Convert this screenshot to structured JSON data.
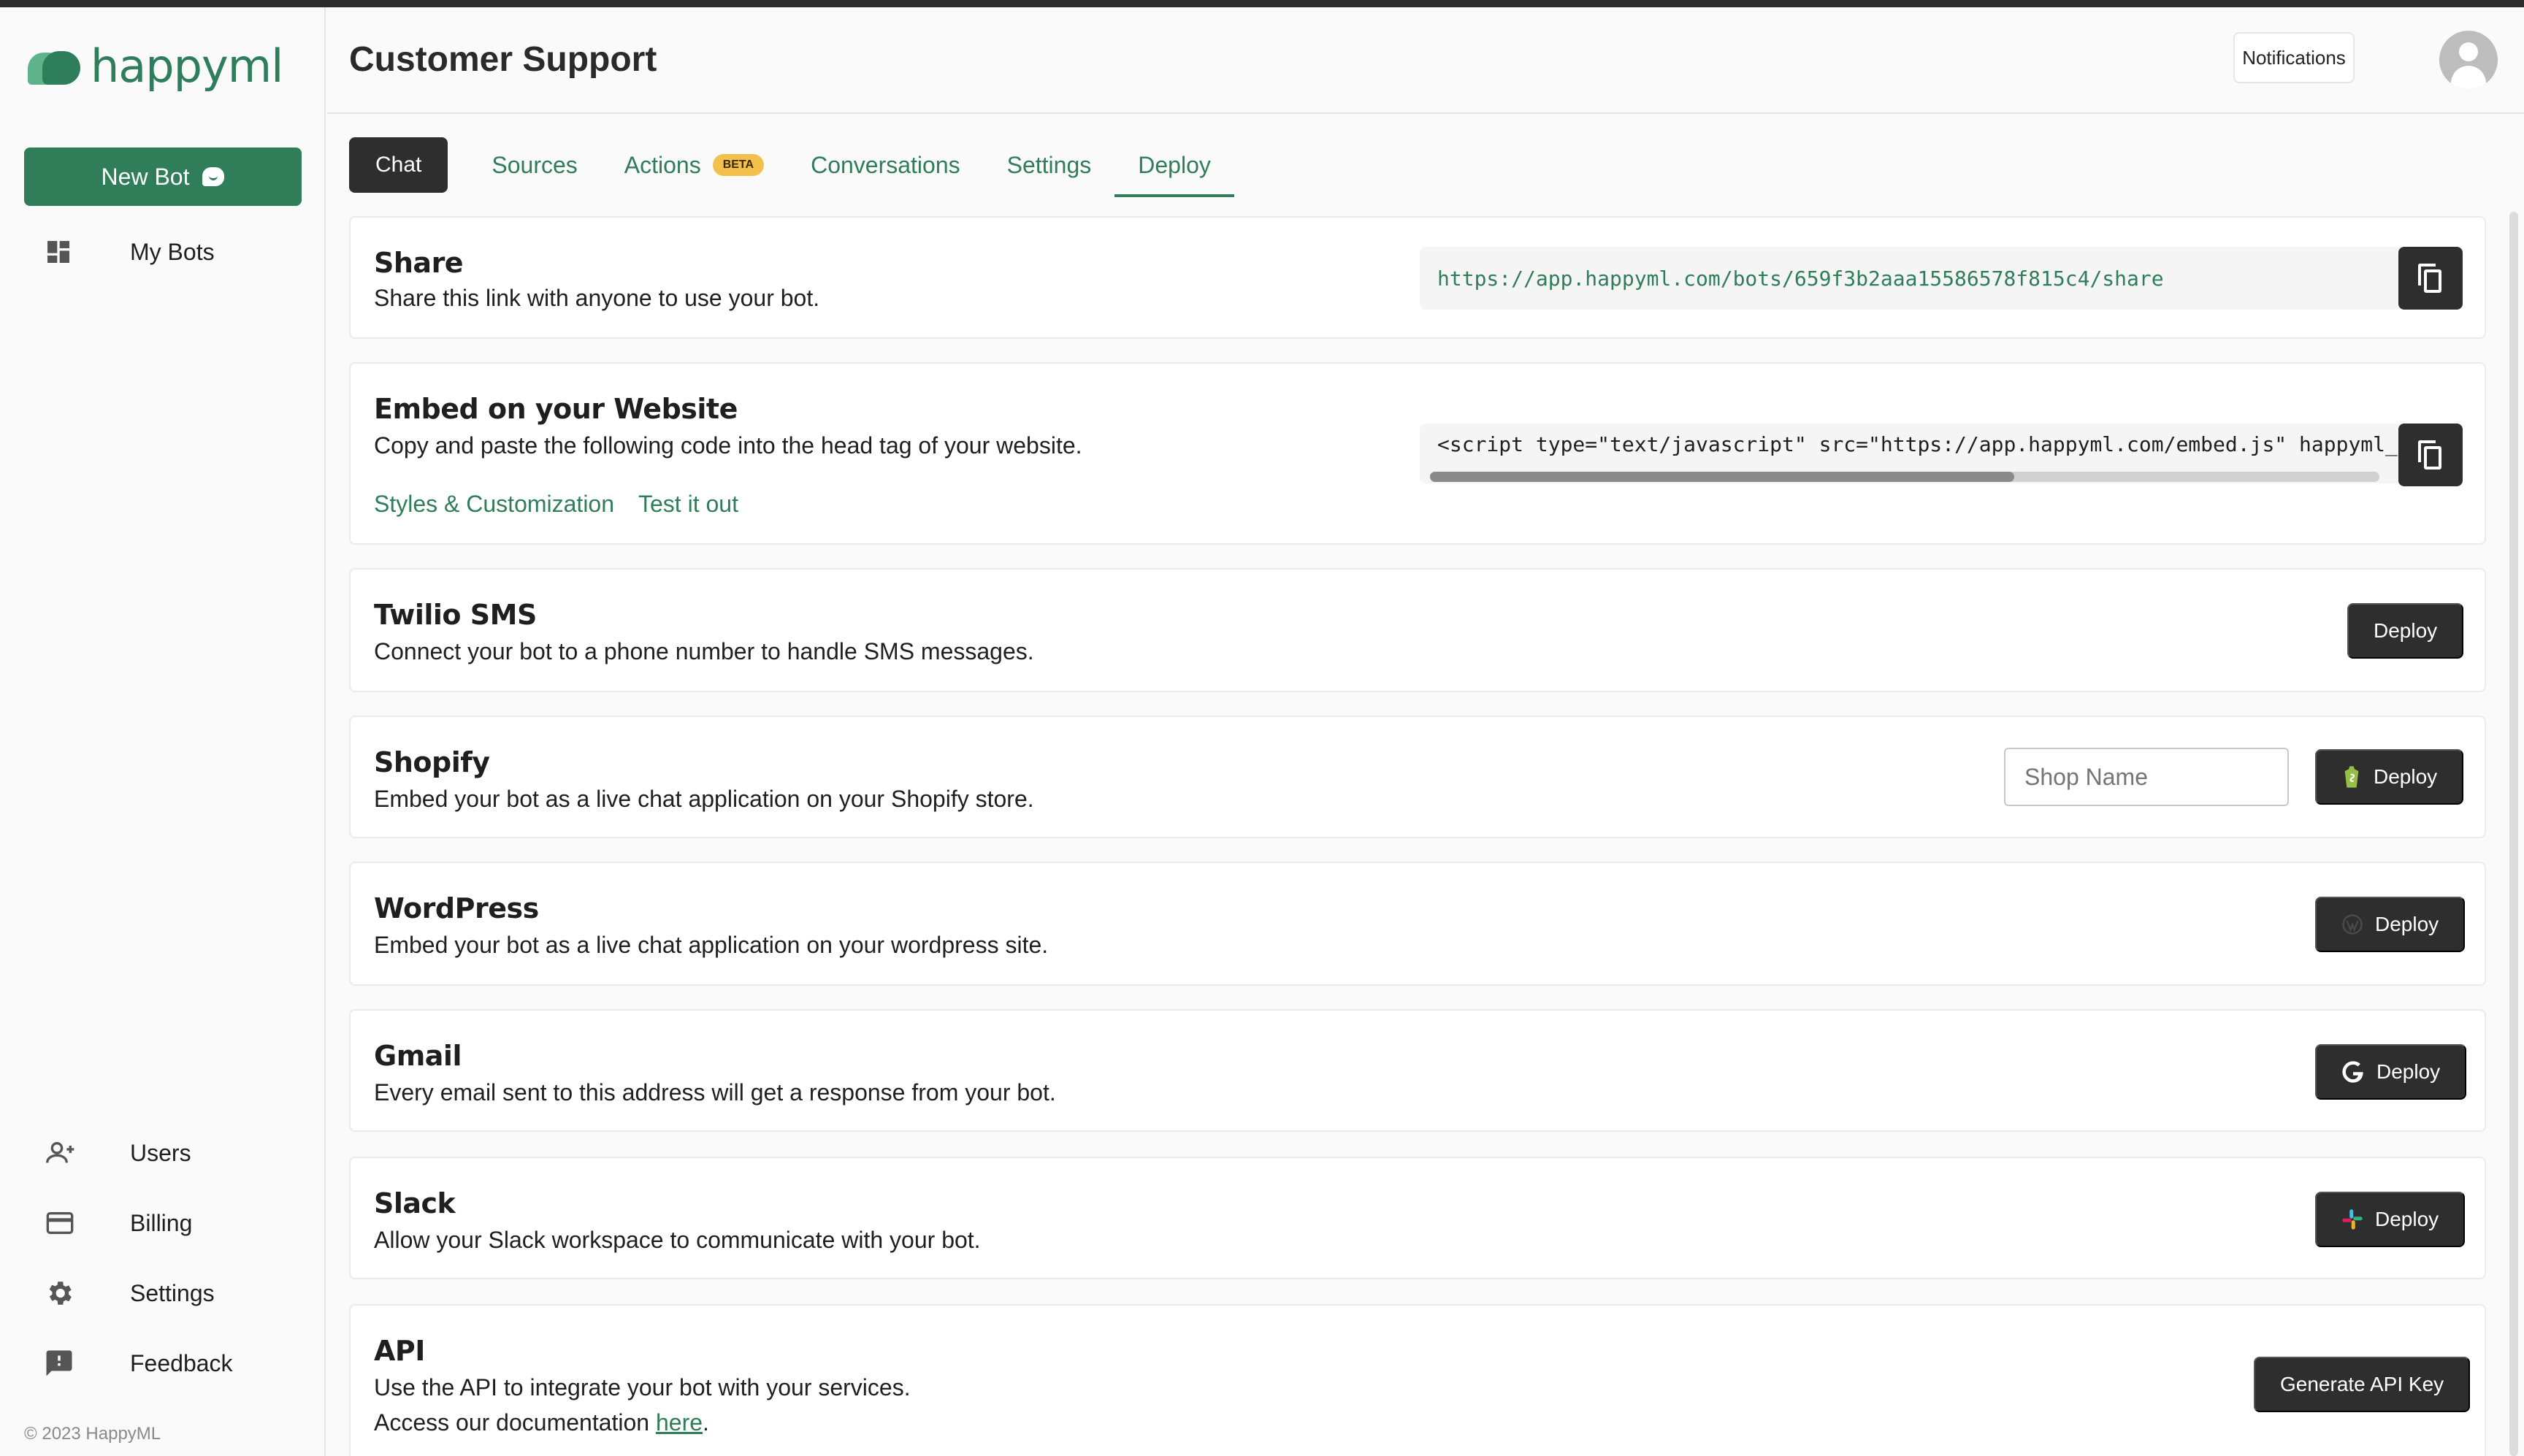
{
  "app": {
    "logo_text": "happyml",
    "copyright": "© 2023 HappyML"
  },
  "sidebar": {
    "new_bot_label": "New Bot",
    "items": [
      {
        "label": "My Bots",
        "icon": "dashboard-icon"
      },
      {
        "label": "Users",
        "icon": "add-user-icon"
      },
      {
        "label": "Billing",
        "icon": "credit-card-icon"
      },
      {
        "label": "Settings",
        "icon": "gear-icon"
      },
      {
        "label": "Feedback",
        "icon": "feedback-icon"
      }
    ]
  },
  "header": {
    "title": "Customer Support",
    "notifications_label": "Notifications"
  },
  "tabs": [
    {
      "label": "Chat"
    },
    {
      "label": "Sources"
    },
    {
      "label": "Actions",
      "badge": "BETA"
    },
    {
      "label": "Conversations"
    },
    {
      "label": "Settings"
    },
    {
      "label": "Deploy"
    }
  ],
  "cards": {
    "share": {
      "title": "Share",
      "desc": "Share this link with anyone to use your bot.",
      "url": "https://app.happyml.com/bots/659f3b2aaa15586578f815c4/share"
    },
    "embed": {
      "title": "Embed on your Website",
      "desc": "Copy and paste the following code into the head tag of your website.",
      "code": "<script type=\"text/javascript\" src=\"https://app.happyml.com/embed.js\" happyml_",
      "link1": "Styles & Customization",
      "link2": "Test it out"
    },
    "twilio": {
      "title": "Twilio SMS",
      "desc": "Connect your bot to a phone number to handle SMS messages.",
      "button": "Deploy"
    },
    "shopify": {
      "title": "Shopify",
      "desc": "Embed your bot as a live chat application on your Shopify store.",
      "input_placeholder": "Shop Name",
      "button": "Deploy"
    },
    "wordpress": {
      "title": "WordPress",
      "desc": "Embed your bot as a live chat application on your wordpress site.",
      "button": "Deploy"
    },
    "gmail": {
      "title": "Gmail",
      "desc": "Every email sent to this address will get a response from your bot.",
      "button": "Deploy"
    },
    "slack": {
      "title": "Slack",
      "desc": "Allow your Slack workspace to communicate with your bot.",
      "button": "Deploy"
    },
    "api": {
      "title": "API",
      "desc": "Use the API to integrate your bot with your services.",
      "doc_prefix": "Access our documentation ",
      "doc_link": "here",
      "doc_suffix": ".",
      "button": "Generate API Key"
    }
  },
  "colors": {
    "brand_green": "#2f7d59",
    "dark_button": "#2e2e2e",
    "beta_badge": "#f3c14b"
  }
}
